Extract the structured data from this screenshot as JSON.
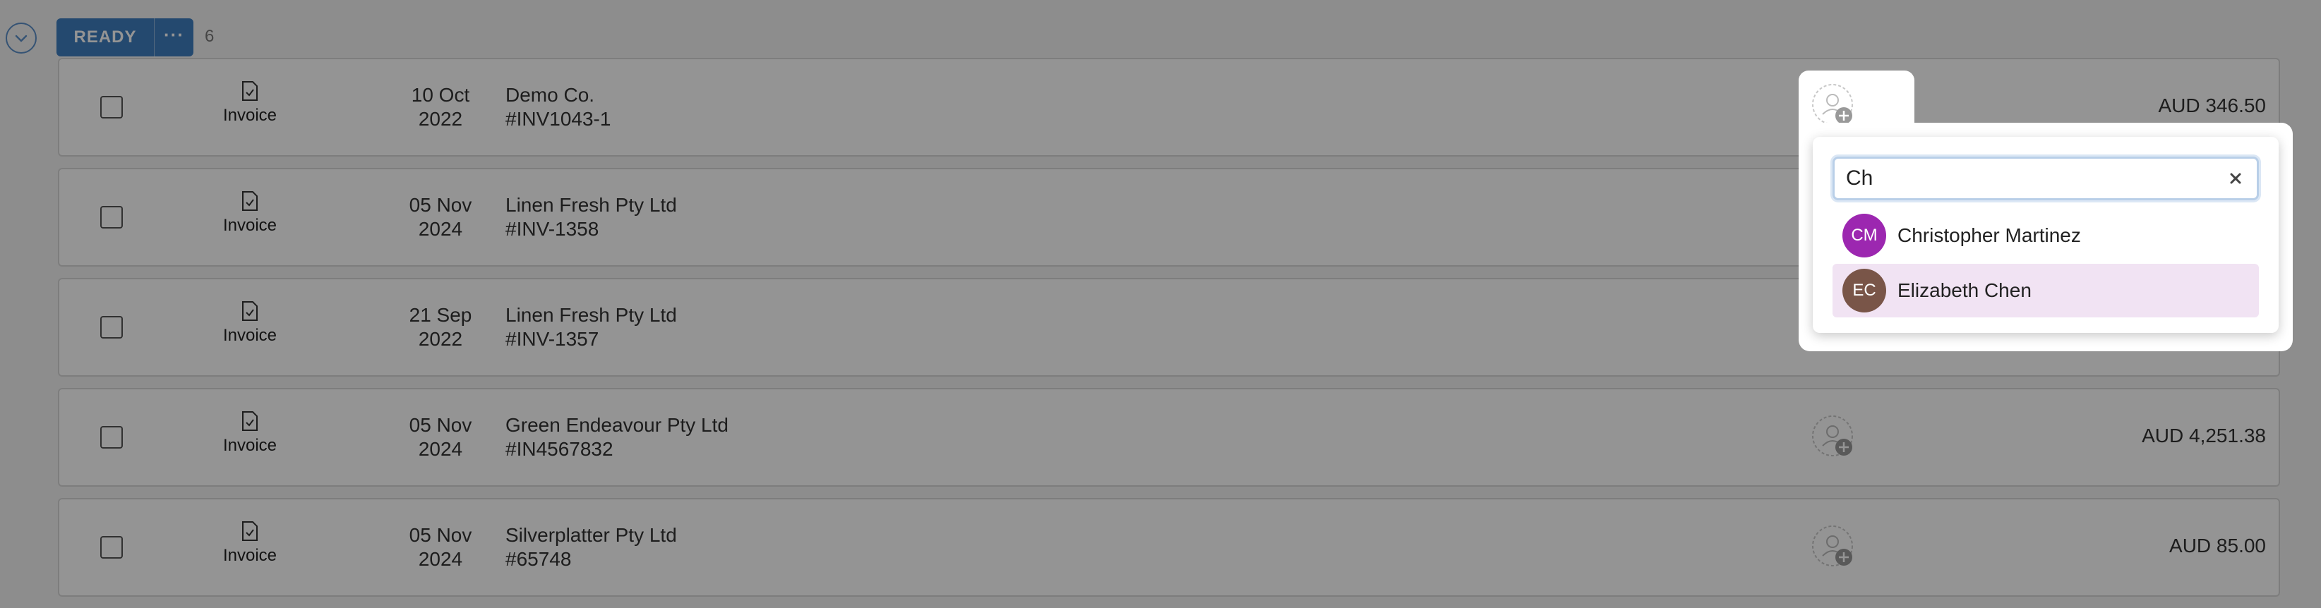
{
  "group": {
    "status_label": "READY",
    "more_label": "···",
    "count": "6"
  },
  "rows": [
    {
      "type": "Invoice",
      "date_line1": "10 Oct",
      "date_line2": "2022",
      "contact": "Demo Co.",
      "reference": "#INV1043-1",
      "amount": "AUD 346.50"
    },
    {
      "type": "Invoice",
      "date_line1": "05 Nov",
      "date_line2": "2024",
      "contact": "Linen Fresh Pty Ltd",
      "reference": "#INV-1358",
      "amount": ""
    },
    {
      "type": "Invoice",
      "date_line1": "21 Sep",
      "date_line2": "2022",
      "contact": "Linen Fresh Pty Ltd",
      "reference": "#INV-1357",
      "amount": ""
    },
    {
      "type": "Invoice",
      "date_line1": "05 Nov",
      "date_line2": "2024",
      "contact": "Green Endeavour Pty Ltd",
      "reference": "#IN4567832",
      "amount": "AUD 4,251.38"
    },
    {
      "type": "Invoice",
      "date_line1": "05 Nov",
      "date_line2": "2024",
      "contact": "Silverplatter Pty Ltd",
      "reference": "#65748",
      "amount": "AUD 85.00"
    }
  ],
  "assignee_popover": {
    "search_value": "Ch",
    "options": [
      {
        "initials": "CM",
        "name": "Christopher Martinez",
        "color": "#9c27b0"
      },
      {
        "initials": "EC",
        "name": "Elizabeth Chen",
        "color": "#795548"
      }
    ]
  },
  "colors": {
    "accent": "#3f7fc0",
    "highlight": "#f1e3f3"
  }
}
